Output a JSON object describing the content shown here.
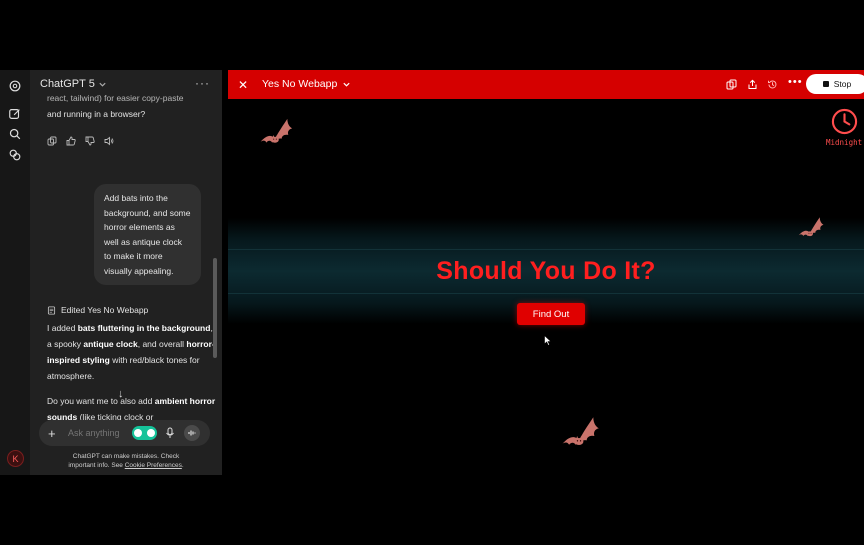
{
  "chat": {
    "model_title": "ChatGPT 5",
    "prev_message_line1": "react, tailwind) for easier copy-paste",
    "prev_message_line2": "and running in a browser?",
    "user_message": "Add bats into the background, and some horror elements as well as antique clock to make it more visually appealing.",
    "edited_label": "Edited Yes No Webapp",
    "reply": {
      "p1_part1": "I added ",
      "p1_bold1": "bats fluttering in the background",
      "p1_part2": ", a spooky ",
      "p1_bold2": "antique clock",
      "p1_part3": ", and overall ",
      "p1_bold3": "horror-inspired styling",
      "p1_part4": " with red/black tones for atmosphere.",
      "p2_part1": "Do you want me to also add ",
      "p2_bold1": "ambient horror sounds",
      "p2_part2": " (like ticking clock or"
    },
    "input_placeholder": "Ask anything",
    "disclaimer_line1": "ChatGPT can make mistakes. Check",
    "disclaimer_line2_prefix": "important info. See ",
    "disclaimer_link": "Cookie Preferences",
    "disclaimer_line2_suffix": ".",
    "avatar_letter": "K"
  },
  "canvas": {
    "title": "Yes No Webapp",
    "stop_label": "Stop",
    "close_glyph": "✕",
    "more_glyph": "•••"
  },
  "app": {
    "headline": "Should You Do It?",
    "button_label": "Find Out",
    "clock_label": "Midnight"
  },
  "colors": {
    "accent_red": "#d50000",
    "headline_red": "#ff1f1f",
    "bat_color": "#c9736b",
    "chat_bg": "#212121"
  },
  "icons": [
    "openai-logo-icon",
    "new-chat-icon",
    "search-icon",
    "library-icon",
    "copy-icon",
    "thumbs-up-icon",
    "thumbs-down-icon",
    "speaker-icon",
    "document-icon",
    "mic-icon",
    "voice-mode-icon",
    "clock-icon",
    "bat-icon",
    "share-icon",
    "history-icon"
  ]
}
